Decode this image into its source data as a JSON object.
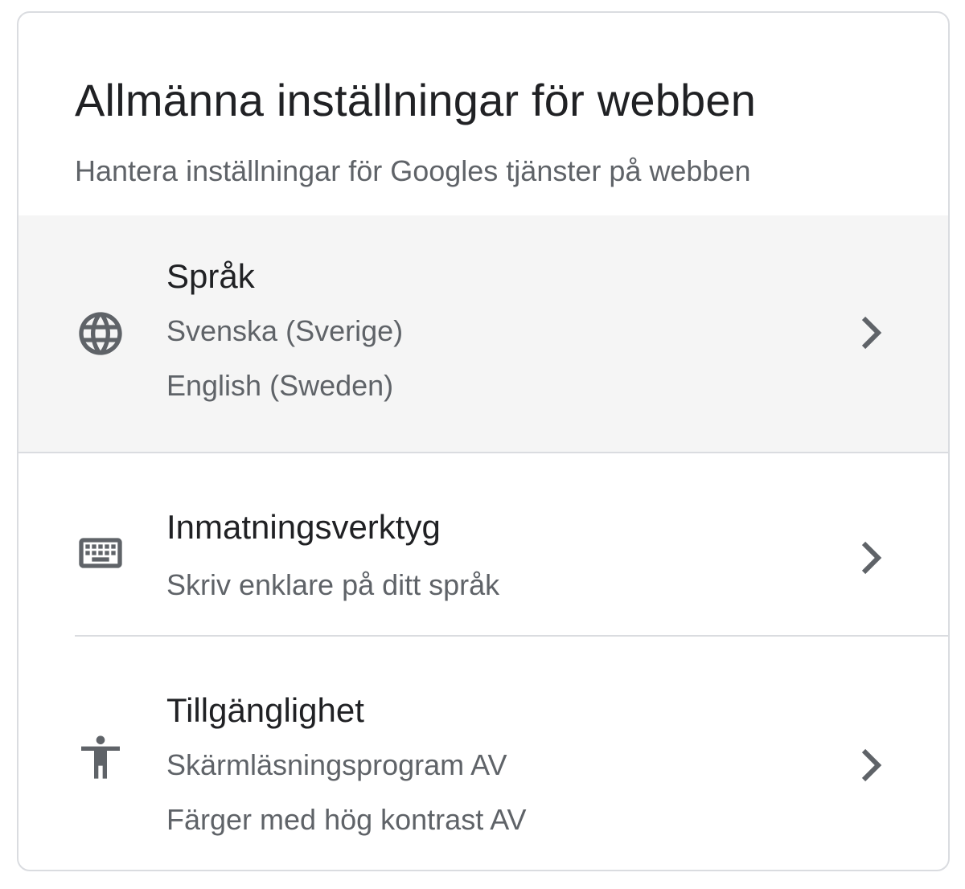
{
  "header": {
    "title": "Allmänna inställningar för webben",
    "subtitle": "Hantera inställningar för Googles tjänster på webben"
  },
  "items": [
    {
      "icon": "globe-icon",
      "title": "Språk",
      "lines": [
        "Svenska (Sverige)",
        "English (Sweden)"
      ],
      "highlighted": true
    },
    {
      "icon": "keyboard-icon",
      "title": "Inmatningsverktyg",
      "lines": [
        "Skriv enklare på ditt språk"
      ],
      "highlighted": false
    },
    {
      "icon": "accessibility-icon",
      "title": "Tillgänglighet",
      "lines": [
        "Skärmläsningsprogram AV",
        "Färger med hög kontrast AV"
      ],
      "highlighted": false
    }
  ],
  "colors": {
    "title_text": "#202124",
    "secondary_text": "#5f6368",
    "icon": "#5f6368",
    "divider": "#dadce0",
    "highlight_bg": "#f5f5f5"
  }
}
